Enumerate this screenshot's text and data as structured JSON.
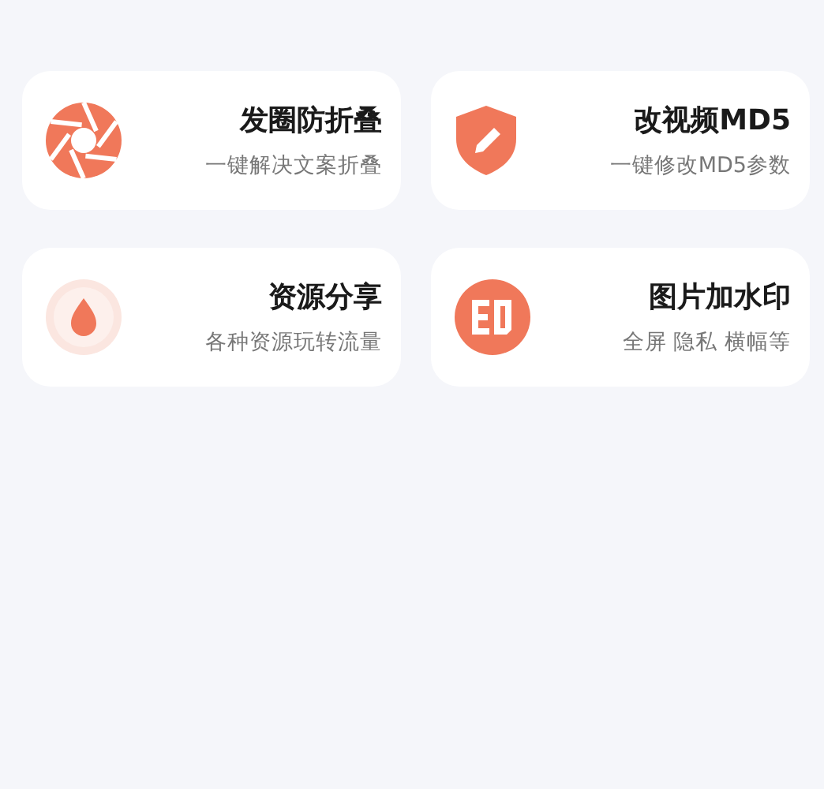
{
  "cards": [
    {
      "kind": "aperture",
      "title": "发圈防折叠",
      "subtitle": "一键解决文案折叠"
    },
    {
      "kind": "shield",
      "title": "改视频MD5",
      "subtitle": "一键修改MD5参数"
    },
    {
      "kind": "drop",
      "title": "资源分享",
      "subtitle": "各种资源玩转流量"
    },
    {
      "kind": "stamp",
      "title": "图片加水印",
      "subtitle": "全屏 隐私 横幅等"
    }
  ]
}
